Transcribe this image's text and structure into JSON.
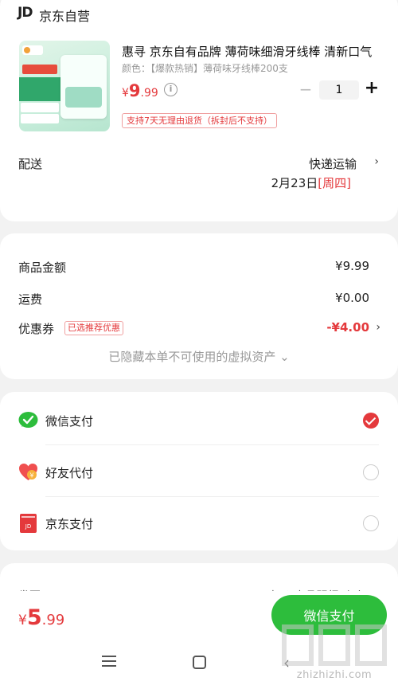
{
  "store": {
    "logo": "JD",
    "name": "京东自营"
  },
  "product": {
    "title": "惠寻 京东自有品牌 薄荷味细滑牙线棒 清新口气",
    "variant": "颜色：【爆款热销】薄荷味牙线棒200支",
    "price_currency": "¥",
    "price_int": "9",
    "price_dec": ".99",
    "quantity": "1",
    "qty_minus": "−",
    "qty_plus": "+",
    "return_policy": "支持7天无理由退货（拆封后不支持）"
  },
  "delivery": {
    "label": "配送",
    "method": "快递运输",
    "date": "2月23日",
    "weekday": "[周四]"
  },
  "pricing": {
    "goods_label": "商品金额",
    "goods_value": "¥9.99",
    "shipping_label": "运费",
    "shipping_value": "¥0.00",
    "coupon_label": "优惠券",
    "coupon_badge": "已选推荐优惠",
    "coupon_value": "-¥4.00",
    "hidden_assets": "已隐藏本单不可使用的虚拟资产 ⌄"
  },
  "payment": {
    "options": [
      {
        "label": "微信支付",
        "icon": "wechat-pay-icon",
        "selected": true
      },
      {
        "label": "好友代付",
        "icon": "friend-pay-icon",
        "selected": false
      },
      {
        "label": "京东支付",
        "icon": "jd-pay-icon",
        "selected": false
      }
    ]
  },
  "peek": {
    "left": "发票",
    "right": "电子(商品明细-个人)"
  },
  "bottom": {
    "total_currency": "¥",
    "total_int": "5",
    "total_dec": ".99",
    "pay_button": "微信支付"
  },
  "watermark": {
    "text": "zhizhizhi.com"
  },
  "colors": {
    "accent_red": "#e4393c",
    "wechat_green": "#2dbd3c",
    "background": "#f2f2f2"
  }
}
